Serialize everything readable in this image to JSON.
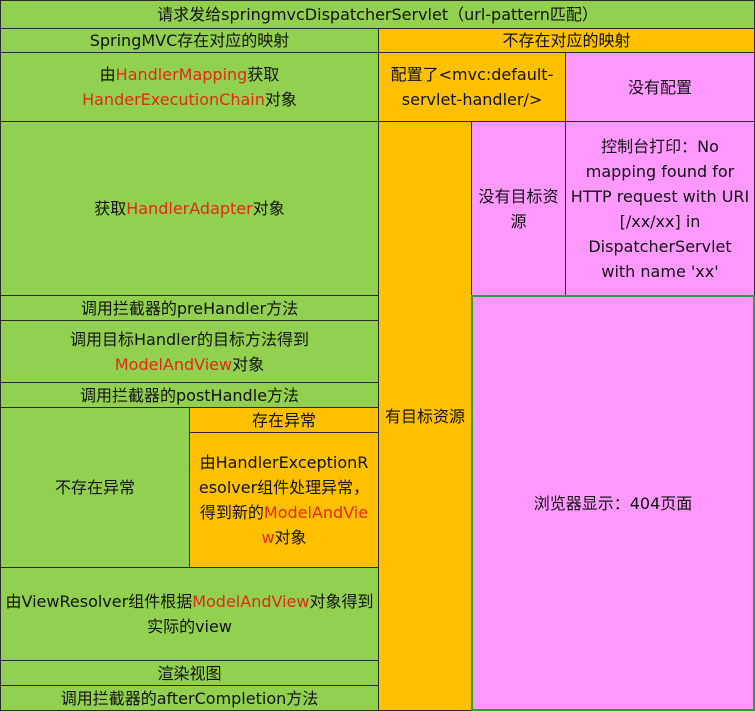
{
  "header": {
    "title": "请求发给springmvcDispatcherServlet（url-pattern匹配）"
  },
  "left": {
    "title": "SpringMVC存在对应的映射",
    "step1": {
      "pre": "由",
      "hl1": "HandlerMapping",
      "mid": "获取",
      "hl2": "HanderExecutionChain",
      "post": "对象"
    },
    "step2": {
      "pre": "获取",
      "hl": "HandlerAdapter",
      "post": "对象"
    },
    "step3": "调用拦截器的preHandler方法",
    "step4": {
      "pre": "调用目标Handler的目标方法得到",
      "hl": "ModelAndView",
      "post": "对象"
    },
    "step5": "调用拦截器的postHandle方法",
    "no_exception": "不存在异常",
    "has_exception": "存在异常",
    "exception_handler": {
      "pre": "由HandlerExceptionResolver组件处理异常，得到新的",
      "hl": "ModelAndView",
      "post": "对象"
    },
    "step6": {
      "pre": "由ViewResolver组件根据",
      "hl": "ModelAndView",
      "post": "对象得到实际的view"
    },
    "step7": "渲染视图",
    "step8": "调用拦截器的afterCompletion方法"
  },
  "right": {
    "title": "不存在对应的映射",
    "configured": "配置了<mvc:default-servlet-handler/>",
    "not_configured": "没有配置",
    "has_target": "有目标资源",
    "no_target": "没有目标资源",
    "console": "控制台打印：No mapping found for HTTP request with URI [/xx/xx] in DispatcherServlet with name 'xx'",
    "browser": "浏览器显示：404页面"
  },
  "colors": {
    "green": "#92d050",
    "orange": "#ffc000",
    "pink": "#ff99ff",
    "highlight": "#e02a14"
  }
}
